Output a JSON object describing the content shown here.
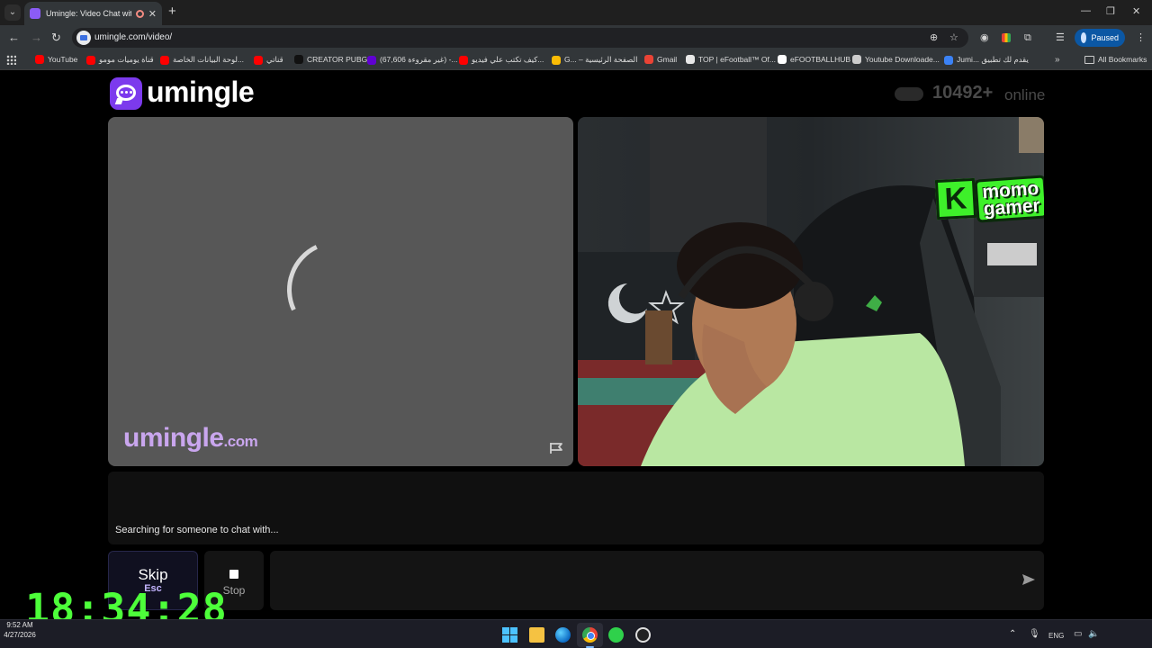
{
  "browser": {
    "tab_title": "Umingle: Video Chat with S",
    "url": "umingle.com/video/",
    "profile_label": "Paused",
    "bookmarks": [
      {
        "label": "YouTube",
        "color": "#ff0000"
      },
      {
        "label": "قناة يوميات مومو",
        "color": "#ff0000"
      },
      {
        "label": "لوحة البيانات الخاصة...",
        "color": "#ff0000"
      },
      {
        "label": "قناتي",
        "color": "#ff0000"
      },
      {
        "label": "CREATOR PUBG",
        "color": "#111111"
      },
      {
        "label": "(67,606 غير مقروءة) -...",
        "color": "#6001d2"
      },
      {
        "label": "كيف تكتب علي فيديو...",
        "color": "#ff0000"
      },
      {
        "label": "G... – الصفحة الرئيسية",
        "color": "#fbbc05"
      },
      {
        "label": "Gmail",
        "color": "#ea4335"
      },
      {
        "label": "TOP | eFootball™ Of...",
        "color": "#e8e8e8"
      },
      {
        "label": "eFOOTBALLHUB",
        "color": "#ffffff"
      },
      {
        "label": "Youtube Downloade...",
        "color": "#cccccc"
      },
      {
        "label": "Jumi... يقدم لك تطبيق",
        "color": "#3b82f6"
      }
    ],
    "all_bookmarks_label": "All Bookmarks"
  },
  "site": {
    "logo_text": "umingle",
    "online_count": "10492+",
    "online_label": "online",
    "watermark_main": "umingle",
    "watermark_suffix": ".com",
    "streamer_badge_letter": "K",
    "streamer_badge_text_1": "momo",
    "streamer_badge_text_2": "gamer",
    "status_message": "Searching for someone to chat with...",
    "skip_label": "Skip",
    "skip_shortcut": "Esc",
    "stop_label": "Stop",
    "message_value": "",
    "accent_color": "#7c3aed"
  },
  "overlay": {
    "clock": "18:34:28"
  },
  "taskbar": {
    "language": "ENG",
    "time": "9:52 AM",
    "date": "4/27/2026"
  }
}
